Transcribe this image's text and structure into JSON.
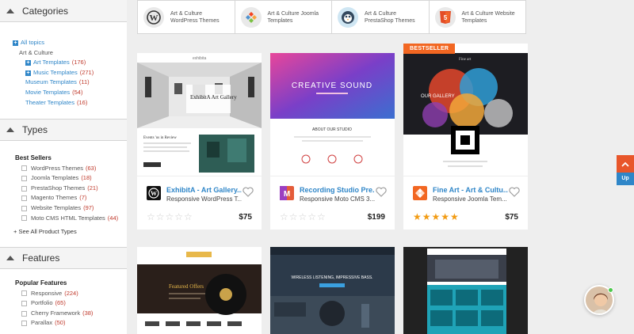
{
  "sidebar": {
    "categories": {
      "title": "Categories",
      "all_topics": "All topics",
      "parent": "Art & Culture",
      "items": [
        {
          "label": "Art Templates",
          "count": "(176)"
        },
        {
          "label": "Music Templates",
          "count": "(271)"
        },
        {
          "label": "Museum Templates",
          "count": "(11)"
        },
        {
          "label": "Movie Templates",
          "count": "(54)"
        },
        {
          "label": "Theater Templates",
          "count": "(16)"
        }
      ]
    },
    "types": {
      "title": "Types",
      "group": "Best Sellers",
      "items": [
        {
          "label": "WordPress Themes",
          "count": "(63)"
        },
        {
          "label": "Joomla Templates",
          "count": "(18)"
        },
        {
          "label": "PrestaShop Themes",
          "count": "(21)"
        },
        {
          "label": "Magento Themes",
          "count": "(7)"
        },
        {
          "label": "Website Templates",
          "count": "(97)"
        },
        {
          "label": "Moto CMS HTML Templates",
          "count": "(44)"
        }
      ],
      "see_all": "+ See All Product Types"
    },
    "features": {
      "title": "Features",
      "group": "Popular Features",
      "items": [
        {
          "label": "Responsive",
          "count": "(224)"
        },
        {
          "label": "Portfolio",
          "count": "(65)"
        },
        {
          "label": "Cherry Framework",
          "count": "(38)"
        },
        {
          "label": "Parallax",
          "count": "(50)"
        }
      ]
    }
  },
  "category_tiles": [
    {
      "line1": "Art & Culture",
      "line2": "WordPress Themes",
      "icon": "wordpress-icon"
    },
    {
      "line1": "Art & Culture Joomla",
      "line2": "Templates",
      "icon": "joomla-icon"
    },
    {
      "line1": "Art & Culture",
      "line2": "PrestaShop Themes",
      "icon": "prestashop-icon"
    },
    {
      "line1": "Art & Culture Website",
      "line2": "Templates",
      "icon": "html5-icon"
    }
  ],
  "products": [
    {
      "name": "ExhibitA - Art Gallery...",
      "desc": "Responsive WordPress T...",
      "price": "$75",
      "thumb_title": "ExhibitA Art Gallery",
      "thumb_sub": "Events 'us in Review"
    },
    {
      "name": "Recording Studio Pre...",
      "desc": "Responsive Moto CMS 3...",
      "price": "$199",
      "thumb_title": "CREATIVE SOUND",
      "thumb_sub": "ABOUT OUR STUDIO"
    },
    {
      "name": "Fine Art - Art & Cultu...",
      "desc": "Responsive Joomla Tem...",
      "price": "$75",
      "badge": "BESTSELLER",
      "thumb_title": "OUR GALLERY",
      "thumb_brand": "Fine art"
    },
    {
      "thumb_title": "Featured Offers"
    },
    {
      "thumb_title": "WIRELESS LISTENING, IMPRESSIVE BASS."
    },
    {
      "thumb_title": ""
    }
  ],
  "stars": {
    "empty": "☆☆☆☆☆",
    "full": "★★★★★"
  },
  "scroll_up_label": "Up",
  "colors": {
    "accent": "#2f86c8",
    "orange": "#f26722",
    "star": "#f29b12"
  }
}
